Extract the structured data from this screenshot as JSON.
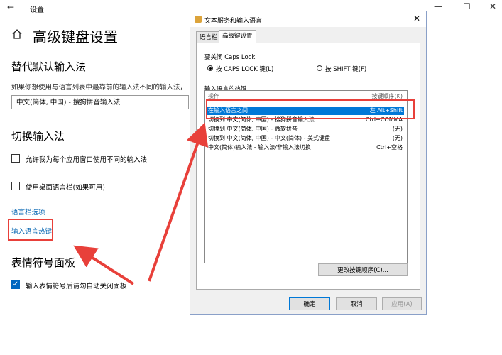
{
  "settings": {
    "app_title": "设置",
    "back_glyph": "←",
    "window_controls": {
      "minimize": "—",
      "maximize": "☐",
      "close": "✕"
    },
    "page_title": "高级键盘设置",
    "section1": {
      "heading": "替代默认输入法",
      "description": "如果你想使用与语言列表中最靠前的输入法不同的输入法，",
      "selected": "中文(简体, 中国) - 搜狗拼音输入法"
    },
    "section2": {
      "heading": "切换输入法",
      "checkbox1": "允许我为每个应用窗口使用不同的输入法",
      "checkbox2": "使用桌面语言栏(如果可用)",
      "link_languagebar": "语言栏选项",
      "link_hotkeys": "输入语言热键"
    },
    "section3": {
      "heading": "表情符号面板",
      "checkbox3": "输入表情符号后请勿自动关闭面板"
    }
  },
  "dialog": {
    "title": "文本服务和输入语言",
    "close_glyph": "✕",
    "tabs": [
      "语言栏",
      "高级键设置"
    ],
    "capslock_group": "要关闭 Caps Lock",
    "radio1": "按 CAPS LOCK 键(L)",
    "radio2": "按 SHIFT 键(F)",
    "hotkey_group": "输入语言的热键",
    "list_header": {
      "action": "操作",
      "keys": "按键顺序(K)"
    },
    "rows": [
      {
        "action": "在输入语言之间",
        "keys": "左 Alt+Shift"
      },
      {
        "action": "切换到 中文(简体, 中国) - 搜狗拼音输入法",
        "keys": "Ctrl+COMMA"
      },
      {
        "action": "切换到 中文(简体, 中国) - 微软拼音",
        "keys": "(无)"
      },
      {
        "action": "切换到 中文(简体, 中国) - 中文(简体) - 美式键盘",
        "keys": "(无)"
      },
      {
        "action": "中文(简体)输入法 - 输入法/非输入法切换",
        "keys": "Ctrl+空格"
      }
    ],
    "change_button": "更改按键顺序(C)...",
    "ok": "确定",
    "cancel": "取消",
    "apply": "应用(A)"
  },
  "colors": {
    "highlight": "#e8403a",
    "selection": "#0078d7",
    "link": "#0063b1"
  }
}
